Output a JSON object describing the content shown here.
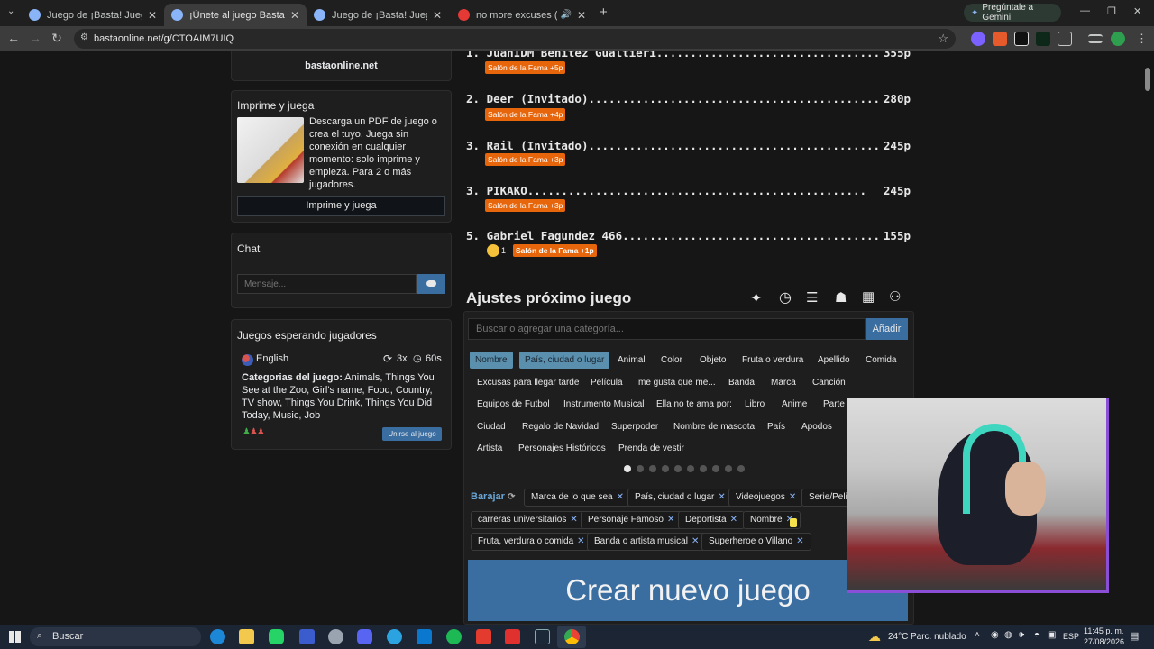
{
  "browser": {
    "tabs": [
      {
        "title": "Juego de ¡Basta! Juega Stop, Tu"
      },
      {
        "title": "¡Únete al juego Basta!"
      },
      {
        "title": "Juego de ¡Basta! Juega Stop, Tu"
      },
      {
        "title": "no more excuses (slowed"
      }
    ],
    "gemini_label": "Pregúntale a Gemini",
    "url": "bastaonline.net/g/CTOAIM7UIQ"
  },
  "sidebar": {
    "site_name": "bastaonline.net",
    "print": {
      "title": "Imprime y juega",
      "description": "Descarga un PDF de juego o crea el tuyo. Juega sin conexión en cualquier momento: solo imprime y empieza. Para 2 o más jugadores.",
      "button": "Imprime y juega"
    },
    "chat": {
      "title": "Chat",
      "placeholder": "Mensaje..."
    },
    "waiting": {
      "title": "Juegos esperando jugadores",
      "language": "English",
      "rounds": "3x",
      "time": "60s",
      "categories_label": "Categorias del juego:",
      "categories": " Animals, Things You See at the Zoo, Girl's name, Food, Country, TV show, Things You Drink, Things You Did Today, Music, Job",
      "join_button": "Unirse al juego"
    }
  },
  "leaderboard": [
    {
      "rank": "1.",
      "name": "JuanIDM Benitez Gualtieri",
      "points": "355p",
      "fame": "Salón de la Fama +5p"
    },
    {
      "rank": "2.",
      "name": "Deer (Invitado)",
      "points": "280p",
      "fame": "Salón de la Fama +4p"
    },
    {
      "rank": "3.",
      "name": "Rail (Invitado)",
      "points": "245p",
      "fame": "Salón de la Fama +3p"
    },
    {
      "rank": "3.",
      "name": "PIKAKO",
      "points": "245p",
      "fame": "Salón de la Fama +3p"
    },
    {
      "rank": "5.",
      "name": "Gabriel Fagundez 466",
      "points": "155p",
      "fame": "Salón de la Fama +1p",
      "reaction_count": "1"
    }
  ],
  "settings": {
    "title": "Ajustes próximo juego",
    "search_placeholder": "Buscar o agregar una categoría...",
    "add_button": "Añadir",
    "categories": [
      {
        "label": "Nombre",
        "selected": true
      },
      {
        "label": "País, ciudad o lugar",
        "selected": true
      },
      {
        "label": "Animal"
      },
      {
        "label": "Color"
      },
      {
        "label": "Objeto"
      },
      {
        "label": "Fruta o verdura"
      },
      {
        "label": "Apellido"
      },
      {
        "label": "Comida"
      },
      {
        "label": "Excusas para llegar tarde"
      },
      {
        "label": "Película"
      },
      {
        "label": "me gusta que me..."
      },
      {
        "label": "Banda"
      },
      {
        "label": "Marca"
      },
      {
        "label": "Canción"
      },
      {
        "label": "Equipos de Futbol"
      },
      {
        "label": "Instrumento Musical"
      },
      {
        "label": "Ella no te ama por:"
      },
      {
        "label": "Libro"
      },
      {
        "label": "Anime"
      },
      {
        "label": "Parte d"
      },
      {
        "label": "Ciudad"
      },
      {
        "label": "Regalo de Navidad"
      },
      {
        "label": "Superpoder"
      },
      {
        "label": "Nombre de mascota"
      },
      {
        "label": "País"
      },
      {
        "label": "Apodos"
      },
      {
        "label": "Artista"
      },
      {
        "label": "Personajes Históricos"
      },
      {
        "label": "Prenda de vestir"
      }
    ],
    "shuffle_label": "Barajar",
    "chosen": [
      "Marca de lo que sea",
      "País, ciudad o lugar",
      "Videojuegos",
      "Serie/Pelic",
      "carreras universitarios",
      "Personaje Famoso",
      "Deportista",
      "Nombre",
      "Fruta, verdura o comida",
      "Banda o artista musical",
      "Superheroe o Villano"
    ],
    "create_button": "Crear nuevo juego"
  },
  "taskbar": {
    "search": "Buscar",
    "temperature": "24°C",
    "weather": "Parc. nublado",
    "lang": "ESP",
    "time": "11:45 p. m.",
    "date": "27/08/2026"
  }
}
